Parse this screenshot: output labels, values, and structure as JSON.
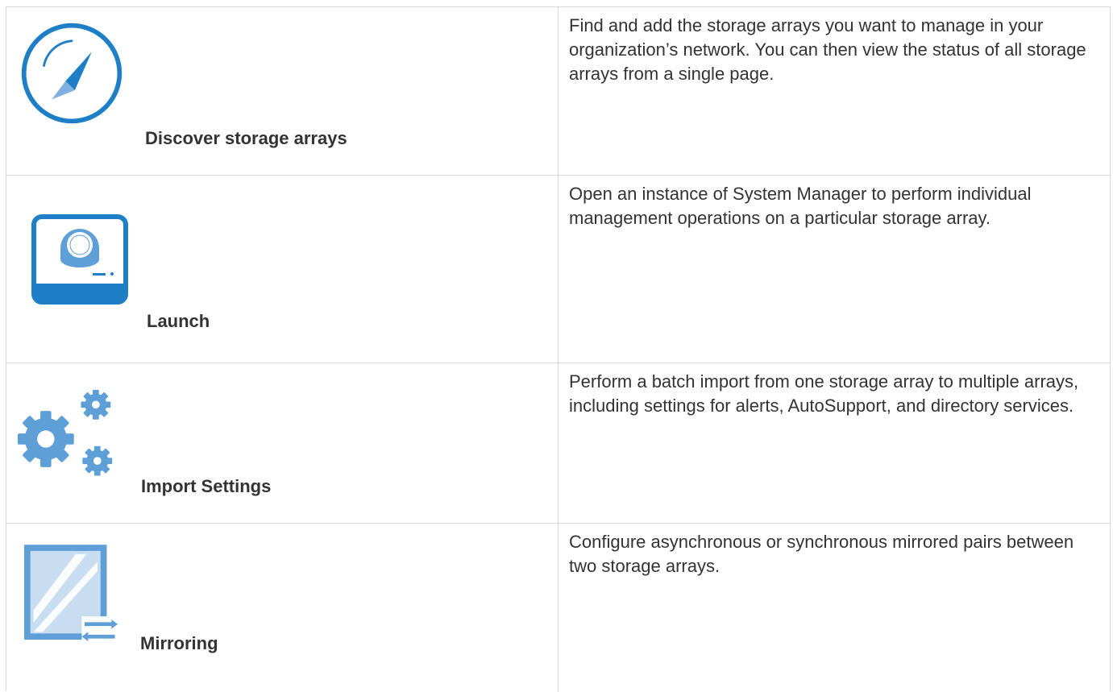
{
  "colors": {
    "primary_blue": "#1f7fc6",
    "light_blue": "#5f9fd8",
    "pale_blue": "#c9ddf0",
    "border": "#d7d7d7",
    "text": "#333333"
  },
  "features": [
    {
      "icon": "compass-icon",
      "title": "Discover storage arrays",
      "description": "Find and add the storage arrays you want to manage in your organization’s network. You can then view the status of all storage arrays from a single page."
    },
    {
      "icon": "storage-launch-icon",
      "title": "Launch",
      "description": "Open an instance of System Manager to perform individual management operations on a particular storage array."
    },
    {
      "icon": "gears-icon",
      "title": "Import Settings",
      "description": "Perform a batch import from one storage array to multiple arrays, including settings for alerts, AutoSupport, and directory services."
    },
    {
      "icon": "mirror-icon",
      "title": "Mirroring",
      "description": "Configure asynchronous or synchronous mirrored pairs between two storage arrays."
    }
  ]
}
